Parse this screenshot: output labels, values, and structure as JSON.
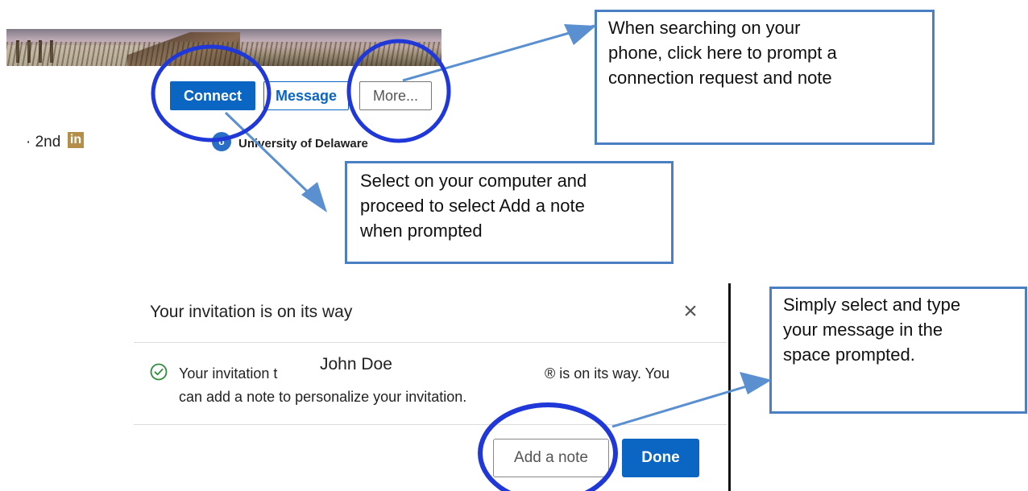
{
  "profile": {
    "connect_label": "Connect",
    "message_label": "Message",
    "more_label": "More...",
    "degree_label": "· 2nd",
    "in_badge": "in",
    "university_logo": "ʊ",
    "university_name": "University of Delaware"
  },
  "callouts": {
    "more_tip": [
      "When searching on your",
      "phone, click here to prompt a",
      "connection request and note"
    ],
    "connect_tip": [
      "Select on your computer and",
      "proceed to select Add a note",
      "when prompted"
    ],
    "note_tip": [
      "Simply select and type",
      "your message in the",
      "space prompted."
    ]
  },
  "dialog": {
    "title": "Your invitation is on its way",
    "close_glyph": "×",
    "text_part1": "Your invitation t",
    "recipient_name": "John Doe",
    "text_part2": "® is on its way. You",
    "text_line2": "can add a note to personalize your invitation.",
    "add_note_label": "Add a note",
    "done_label": "Done"
  },
  "colors": {
    "linkedin_blue": "#0a66c2",
    "annotation_blue": "#2038d8",
    "callout_border": "#4a7fc4",
    "arrow_blue": "#5a8fd0",
    "check_green": "#2e8b3c"
  },
  "icons": {
    "close": "close-icon",
    "check": "check-circle-icon",
    "linkedin": "linkedin-badge-icon",
    "university": "university-logo-icon"
  }
}
